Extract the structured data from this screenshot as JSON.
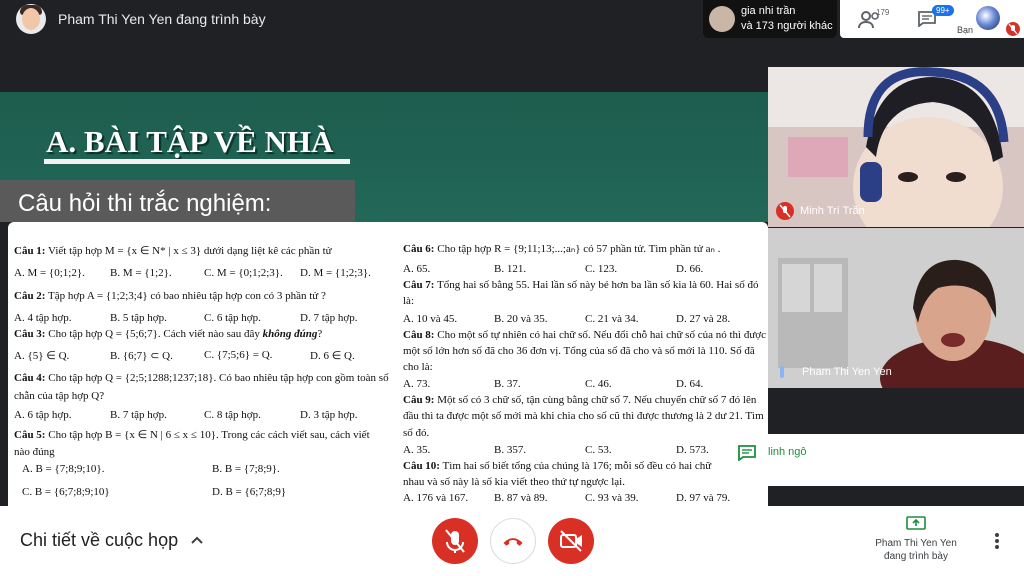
{
  "presenter_bar": {
    "title": "Pham Thi Yen Yen đang trình bày"
  },
  "others": {
    "line1": "gia nhi trần",
    "line2": "và 173 người khác"
  },
  "top_right": {
    "people_count": "179",
    "chat_badge": "99+",
    "you_label": "Bạn"
  },
  "slide": {
    "heading": "A. BÀI TẬP VỀ NHÀ",
    "subheading": "Câu hỏi thi trắc nghiệm:",
    "left_column": [
      "Viết tập hợp M = {x ∈ N* | x ≤ 3} dưới dạng liệt kê các phần tử",
      "A. M = {0;1;2}.",
      "B. M = {1;2}.",
      "C. M = {0;1;2;3}.",
      "D. M = {1;2;3}.",
      "Tập hợp A = {1;2;3;4} có bao nhiêu tập hợp con có 3 phần tử ?",
      "A. 4 tập hợp.",
      "B. 5 tập hợp.",
      "C. 6 tập hợp.",
      "D. 7 tập hợp.",
      "Cho tập hợp Q = {5;6;7}. Cách viết nào sau đây",
      "không đúng",
      "?",
      "A. {5} ∈ Q.",
      "B. {6;7} ⊂ Q.",
      "C. {7;5;6} = Q.",
      "D. 6 ∈ Q.",
      "Cho tập hợp Q = {2;5;1288;1237;18}. Có bao nhiêu tập hợp con gồm toàn số",
      "chẵn của tập hợp Q?",
      "A. 6 tập hợp.",
      "B. 7 tập hợp.",
      "C. 8 tập hợp.",
      "D. 3 tập hợp.",
      "Cho tập hợp B = {x ∈ N | 6 ≤ x ≤ 10}. Trong các cách viết sau, cách viết",
      "nào đúng",
      "A. B = {7;8;9;10}.",
      "B. B = {7;8;9}.",
      "C. B = {6;7;8;9;10}",
      "D. B = {6;7;8;9}"
    ],
    "right_column": [
      "Cho tập hợp R = {9;11;13;...;aₙ} có 57 phần tử. Tìm phần tử aₙ .",
      "A. 65.",
      "B. 121.",
      "C. 123.",
      "D. 66.",
      "Tổng hai số bằng 55. Hai lần số này bé hơn ba lần số kia là 60. Hai số đó",
      "là:",
      "A. 10 và 45.",
      "B. 20 và 35.",
      "C. 21 và 34.",
      "D. 27 và 28.",
      "Cho một số tự nhiên có hai chữ số. Nếu đổi chỗ hai chữ số của nó thì được",
      "một số lớn hơn số đã cho 36 đơn vị. Tổng của số đã cho và số mới là 110. Số đã",
      "cho là:",
      "A. 73.",
      "B. 37.",
      "C. 46.",
      "D. 64.",
      "Một số có 3 chữ số, tận cùng bằng chữ số 7. Nếu chuyển chữ số 7 đó lên",
      "đầu thì ta được một số mới mà khi chia cho số cũ thì được thương là 2 dư 21. Tìm",
      "số đó.",
      "A. 35.",
      "B. 357.",
      "C. 53.",
      "D. 573.",
      "Tìm hai số biết tổng của chúng là 176; mỗi số đều có hai chữ",
      "nhau và số này là số kia viết theo thứ tự ngược lại.",
      "A. 176 và 167.",
      "B. 87 và 89.",
      "C. 93 và 39.",
      "D. 97 và 79."
    ],
    "question_labels": [
      "Câu 1:",
      "Câu 2:",
      "Câu 3:",
      "Câu 4:",
      "Câu 5:",
      "Câu 6:",
      "Câu 7:",
      "Câu 8:",
      "Câu 9:",
      "Câu 10:"
    ]
  },
  "participants": [
    {
      "name": "Minh Trí Trần",
      "muted": true
    },
    {
      "name": "Pham Thi Yen Yen",
      "muted": false
    }
  ],
  "chat_popup": {
    "name": "linh ngô"
  },
  "bottom_bar": {
    "details": "Chi tiết về cuộc họp",
    "presenting_line1": "Pham Thi Yen Yen",
    "presenting_line2": "đang trình bày"
  },
  "colors": {
    "mute_red": "#d93025",
    "slide_green": "#1d5d4e",
    "accent_blue": "#1a73e8"
  }
}
